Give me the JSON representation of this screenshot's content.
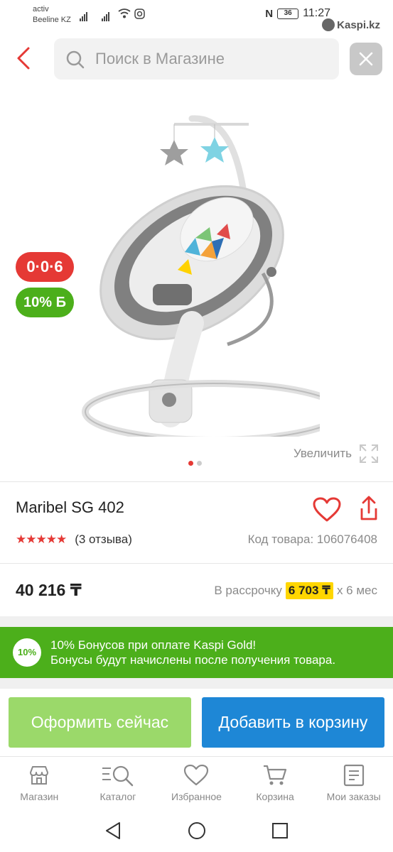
{
  "status_bar": {
    "carrier_line1": "activ",
    "carrier_line2": "Beeline KZ",
    "battery": "36",
    "time": "11:27",
    "watermark": "Kaspi.kz"
  },
  "header": {
    "search_placeholder": "Поиск в Магазине"
  },
  "gallery": {
    "badge_installment": "0·0·6",
    "badge_bonus": "10% Б",
    "zoom_label": "Увеличить",
    "dots_total": 2,
    "dots_active": 0
  },
  "product": {
    "title": "Maribel SG 402",
    "rating_stars": "★★★★★",
    "rating_value": 5,
    "reviews": "(3 отзыва)",
    "sku": "Код товара: 106076408",
    "price": "40 216 ₸",
    "installment_prefix": "В рассрочку",
    "installment_amount": "6 703 ₸",
    "installment_suffix": "x 6 мес"
  },
  "bonus_banner": {
    "badge": "10%",
    "line1": "10% Бонусов при оплате Kaspi Gold!",
    "line2": "Бонусы будут начислены после получения товара."
  },
  "actions": {
    "checkout_label": "Оформить сейчас",
    "add_to_cart_label": "Добавить в корзину"
  },
  "bottom_nav": {
    "items": [
      {
        "label": "Магазин",
        "icon": "store-icon"
      },
      {
        "label": "Каталог",
        "icon": "catalog-search-icon"
      },
      {
        "label": "Избранное",
        "icon": "heart-icon"
      },
      {
        "label": "Корзина",
        "icon": "cart-icon"
      },
      {
        "label": "Мои заказы",
        "icon": "orders-icon"
      }
    ]
  },
  "colors": {
    "brand_red": "#e53935",
    "bonus_green": "#4caf1b",
    "checkout_green": "#9bd96a",
    "cart_blue": "#1e87d6",
    "installment_yellow": "#ffd600"
  }
}
